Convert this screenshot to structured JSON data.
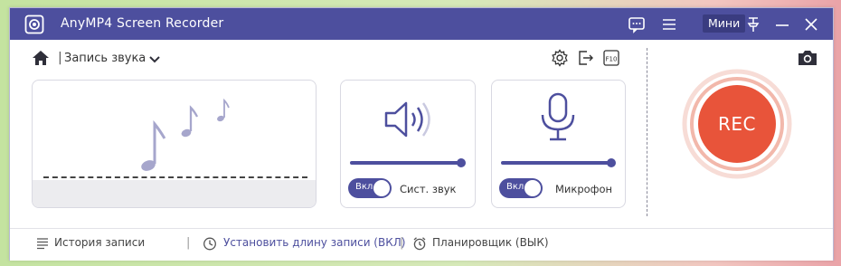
{
  "window": {
    "title": "AnyMP4 Screen Recorder",
    "mini_label": "Мини",
    "accent_color": "#4d4f9e",
    "icons": [
      "app-logo-icon",
      "feedback-icon",
      "menu-icon",
      "pin-icon",
      "minimize-icon",
      "close-icon"
    ]
  },
  "toolbar": {
    "mode_label": "Запись звука",
    "separator": "|",
    "icons": [
      "home-icon",
      "chevron-down-icon",
      "settings-icon",
      "export-icon",
      "fullscreen-icon"
    ]
  },
  "system_sound": {
    "toggle_label": "Вкл",
    "label": "Сист. звук",
    "toggle_on": true,
    "volume": 1.0,
    "icon": "speaker-icon"
  },
  "microphone": {
    "toggle_label": "Вкл",
    "label": "Микрофон",
    "toggle_on": true,
    "volume": 1.0,
    "icon": "microphone-icon"
  },
  "rec": {
    "label": "REC",
    "color": "#e8543a"
  },
  "footer": {
    "history_label": "История записи",
    "length_label": "Установить длину записи (ВКЛ)",
    "scheduler_label": "Планировщик (ВЫК)",
    "separator": "|"
  }
}
